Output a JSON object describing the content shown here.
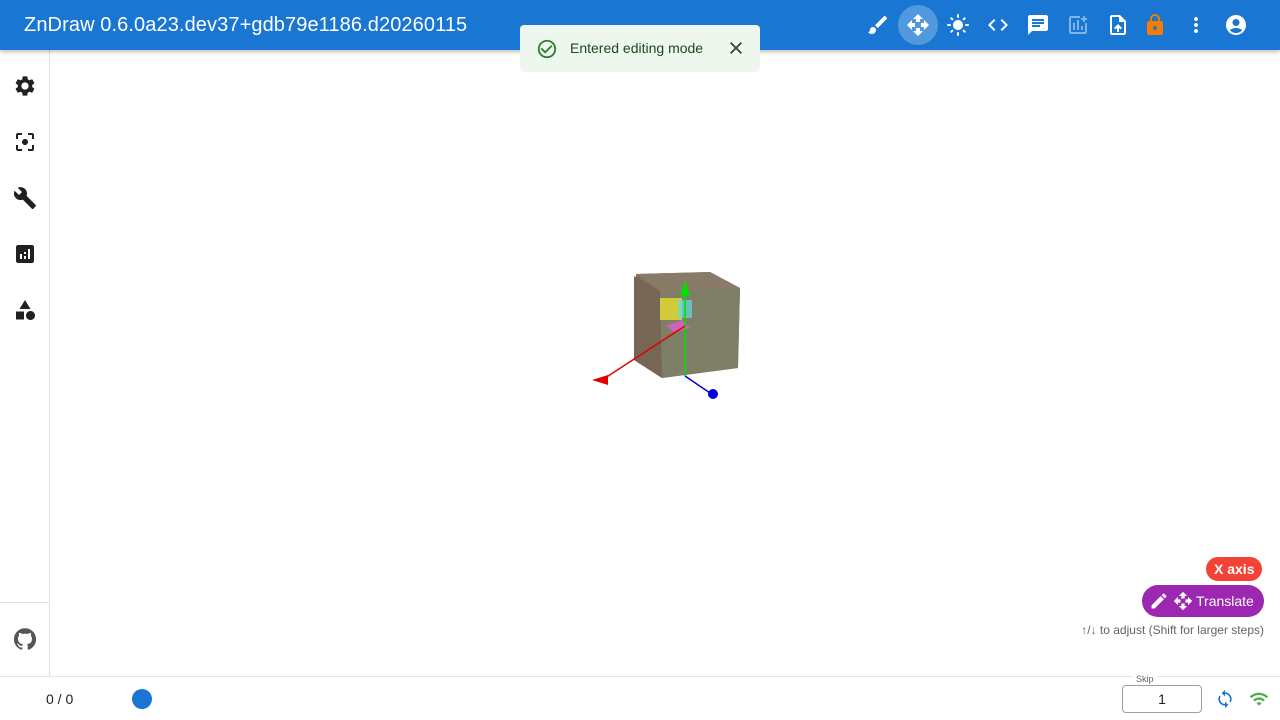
{
  "app": {
    "title": "ZnDraw 0.6.0a23.dev37+gdb79e1186.d20260115"
  },
  "toolbar": {
    "items": [
      {
        "name": "brush-icon",
        "state": "normal"
      },
      {
        "name": "move-icon",
        "state": "active"
      },
      {
        "name": "brightness-icon",
        "state": "normal"
      },
      {
        "name": "code-icon",
        "state": "normal"
      },
      {
        "name": "chat-icon",
        "state": "normal"
      },
      {
        "name": "add-chart-icon",
        "state": "disabled"
      },
      {
        "name": "upload-file-icon",
        "state": "normal"
      },
      {
        "name": "lock-icon",
        "state": "warning"
      },
      {
        "name": "more-vert-icon",
        "state": "normal"
      },
      {
        "name": "account-icon",
        "state": "normal"
      }
    ]
  },
  "snackbar": {
    "message": "Entered editing mode",
    "severity": "success"
  },
  "sidebar": {
    "items": [
      "gear-icon",
      "center-focus-icon",
      "wrench-icon",
      "analytics-icon",
      "shapes-icon"
    ],
    "footer": "github-icon"
  },
  "viewport": {
    "axis_chip": "X axis",
    "mode_chip": "Translate",
    "hint": "↑/↓ to adjust (Shift for larger steps)"
  },
  "bottombar": {
    "frame_counter": "0 / 0",
    "skip_label": "Skip",
    "skip_value": "1"
  },
  "colors": {
    "appbar": "#1976d2",
    "axis_chip": "#f44336",
    "mode_chip": "#9c27b0",
    "lock": "#f57c00",
    "connection": "#4caf50"
  }
}
